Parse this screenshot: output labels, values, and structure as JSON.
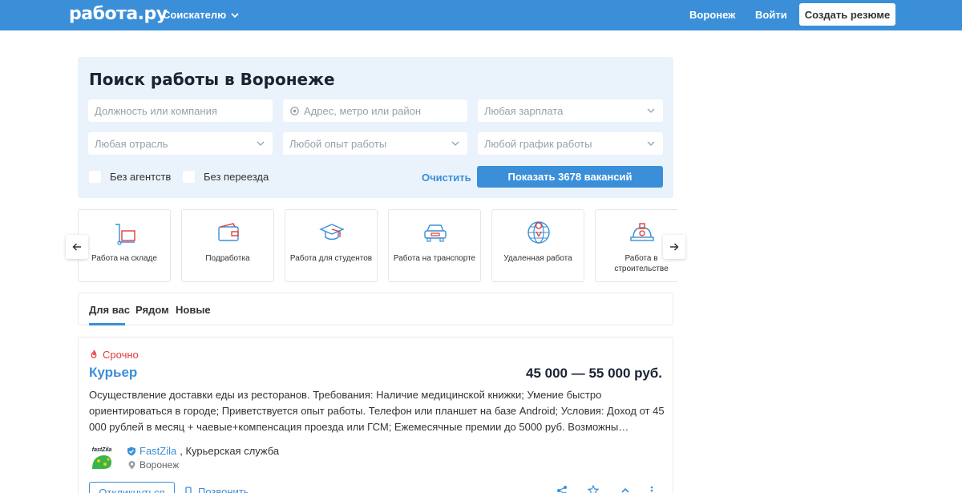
{
  "header": {
    "logo": "работа.ру",
    "seekers_menu": "Соискателю",
    "city": "Воронеж",
    "login": "Войти",
    "create_resume": "Создать резюме"
  },
  "search": {
    "title": "Поиск работы в Воронеже",
    "position_placeholder": "Должность или компания",
    "address_placeholder": "Адрес, метро или район",
    "salary_select": "Любая зарплата",
    "industry_select": "Любая отрасль",
    "experience_select": "Любой опыт работы",
    "schedule_select": "Любой график работы",
    "no_agencies": "Без агентств",
    "no_relocation": "Без переезда",
    "clear": "Очистить",
    "show_button": "Показать 3678 вакансий"
  },
  "categories": [
    {
      "label": "Работа на складе",
      "icon": "warehouse-cart-icon"
    },
    {
      "label": "Подработка",
      "icon": "wallet-icon"
    },
    {
      "label": "Работа для студентов",
      "icon": "graduation-cap-icon"
    },
    {
      "label": "Работа на транспорте",
      "icon": "car-icon"
    },
    {
      "label": "Удаленная работа",
      "icon": "globe-pin-icon"
    },
    {
      "label": "Работа в строительстве",
      "icon": "hard-hat-icon"
    }
  ],
  "tabs": [
    "Для вас",
    "Рядом",
    "Новые"
  ],
  "vacancy": {
    "badge": "Срочно",
    "title": "Курьер",
    "salary": "45 000 — 55 000 руб.",
    "description": "Осуществление доставки еды из ресторанов. Требования: Наличие медицинской книжки; Умение быстро ориентироваться в городе; Приветствуется опыт работы. Телефон или планшет на базе Android; Условия: Доход от 45 000 рублей в месяц + чаевые+компенсация проезда или ГСМ; Ежемесячные премии до 5000 руб. Возможны…",
    "company": "FastZila",
    "company_type": ", Курьерская служба",
    "logo_text": "fastZila",
    "location": "Воронеж",
    "respond": "Откликнуться",
    "call": "Позвонить"
  },
  "colors": {
    "brand": "#3a8fd8",
    "urgent": "#e53935",
    "panel": "#eaf2fb"
  }
}
